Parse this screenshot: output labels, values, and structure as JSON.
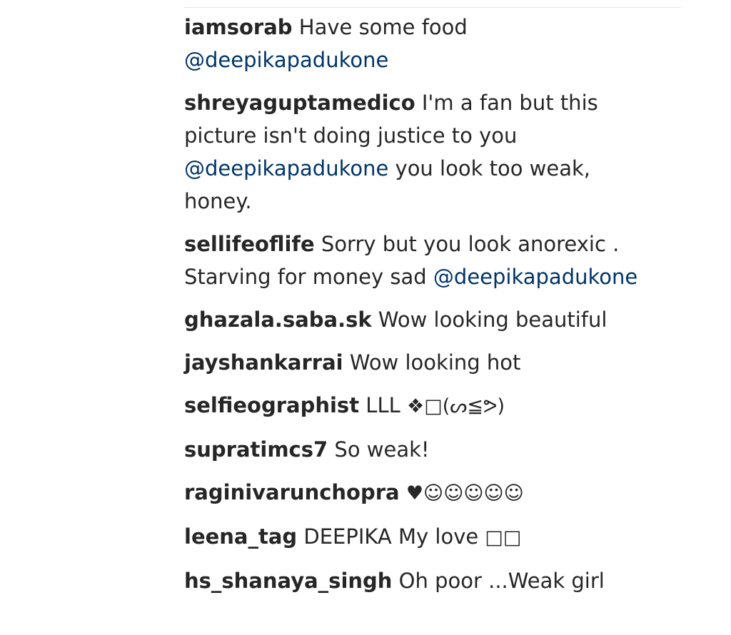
{
  "comments": [
    {
      "username": "iamsorab",
      "parts": [
        {
          "type": "text",
          "value": "Have some food "
        },
        {
          "type": "mention",
          "value": "@deepikapadukone"
        }
      ]
    },
    {
      "username": "shreyaguptamedico",
      "parts": [
        {
          "type": "text",
          "value": "I'm a fan but this picture isn't doing justice to you "
        },
        {
          "type": "mention",
          "value": "@deepikapadukone"
        },
        {
          "type": "text",
          "value": " you look too weak, honey."
        }
      ]
    },
    {
      "username": "sellifeoflife",
      "parts": [
        {
          "type": "text",
          "value": "Sorry but you look anorexic . Starving for money sad "
        },
        {
          "type": "mention",
          "value": "@deepikapadukone"
        }
      ]
    },
    {
      "username": "ghazala.saba.sk",
      "parts": [
        {
          "type": "text",
          "value": "Wow looking beautiful"
        }
      ]
    },
    {
      "username": "jayshankarrai",
      "parts": [
        {
          "type": "text",
          "value": "Wow looking hot"
        }
      ]
    },
    {
      "username": "selfieographist",
      "parts": [
        {
          "type": "text",
          "value": "LLL "
        },
        {
          "type": "emoji",
          "value": "❖□(ᔕ≦ᕗ)"
        }
      ]
    },
    {
      "username": "supratimcs7",
      "parts": [
        {
          "type": "text",
          "value": "So weak!"
        }
      ]
    },
    {
      "username": "raginivarunchopra",
      "parts": [
        {
          "type": "emoji",
          "value": "♥☺☺☺☺☺"
        }
      ]
    },
    {
      "username": "leena_tag",
      "parts": [
        {
          "type": "text",
          "value": "DEEPIKA My love "
        },
        {
          "type": "emoji",
          "value": "□□"
        }
      ]
    },
    {
      "username": "hs_shanaya_singh",
      "parts": [
        {
          "type": "text",
          "value": "Oh poor ...Weak girl"
        }
      ]
    }
  ]
}
